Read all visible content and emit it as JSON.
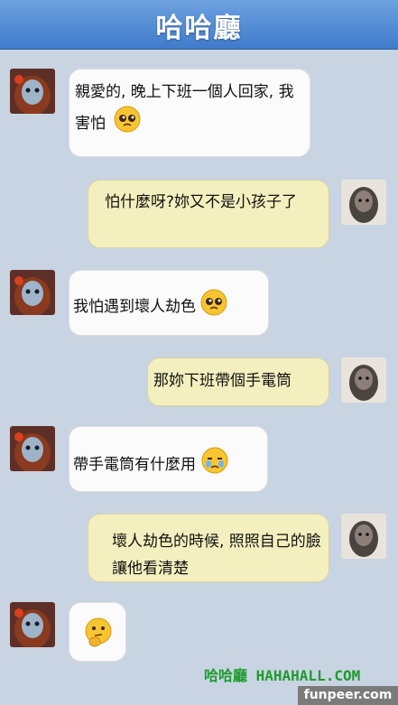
{
  "header": {
    "title": "哈哈廳"
  },
  "messages": [
    {
      "side": "in",
      "text": "親愛的, 晚上下班一個人回家, 我害怕",
      "emoji": "pleading-face-emoji"
    },
    {
      "side": "out",
      "text": "怕什麼呀?妳又不是小孩子了"
    },
    {
      "side": "in",
      "text": "我怕遇到壞人劫色",
      "emoji": "pleading-face-emoji"
    },
    {
      "side": "out",
      "text": "那妳下班帶個手電筒"
    },
    {
      "side": "in",
      "text": "帶手電筒有什麼用",
      "emoji": "crying-face-emoji"
    },
    {
      "side": "out",
      "text": "壞人劫色的時候, 照照自己的臉讓他看清楚"
    },
    {
      "side": "in",
      "text": "",
      "emoji": "thinking-face-emoji"
    }
  ],
  "watermark": {
    "text": "哈哈廳 HAHAHALL.COM"
  },
  "footer": {
    "text": "funpeer.com"
  },
  "colors": {
    "header": "#4a86d4",
    "background": "#c9d4e2",
    "bubble_in": "#fbfbfb",
    "bubble_out": "#f4efbe",
    "watermark": "#1e9b2e"
  }
}
